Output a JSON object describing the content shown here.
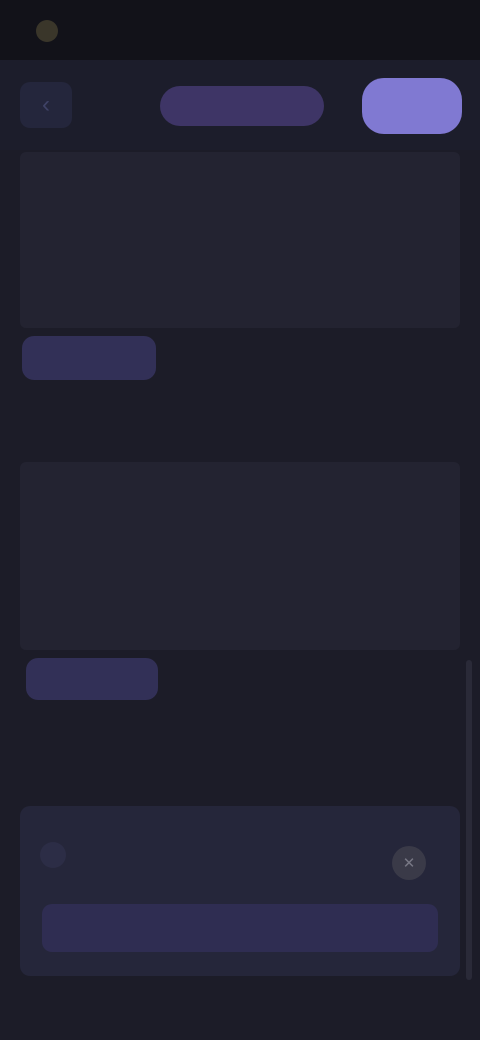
{
  "status_bar": {
    "title": "",
    "right_text": ""
  },
  "nav": {
    "back_icon": "arrow-left-icon",
    "pill_label": "",
    "cta_label": ""
  },
  "section1": {
    "label": "",
    "value": "",
    "sub_label": "",
    "sub_value": "",
    "button_label": ""
  },
  "section2": {
    "heading": "",
    "field1_label": "",
    "field1_value": "",
    "field2_label": "",
    "field2_value": "",
    "button_label": ""
  },
  "notice": {
    "heading": "",
    "title": "",
    "text": "",
    "icon": "info-icon",
    "close_icon": "close-icon",
    "button_label": ""
  },
  "colors": {
    "background": "#1c1c28",
    "card": "#232331",
    "accent": "#8079d2",
    "accent_muted": "#3e3566"
  }
}
